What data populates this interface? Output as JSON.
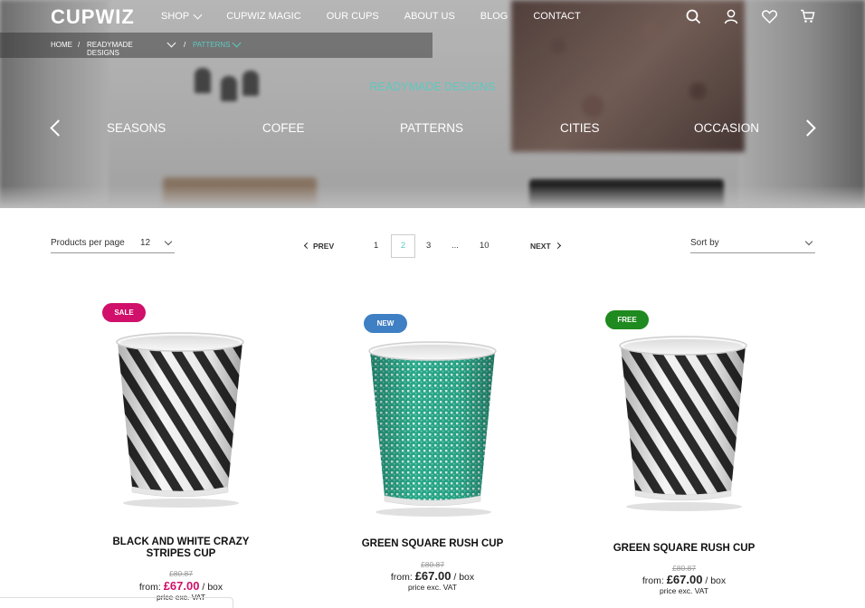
{
  "header": {
    "logo": "CUPWIZ",
    "nav": [
      {
        "label": "SHOP",
        "has_dropdown": true
      },
      {
        "label": "CUPWIZ MAGIC"
      },
      {
        "label": "OUR CUPS"
      },
      {
        "label": "ABOUT US"
      },
      {
        "label": "BLOG"
      },
      {
        "label": "CONTACT"
      }
    ],
    "icons": [
      "search-icon",
      "user-icon",
      "heart-icon",
      "cart-icon"
    ]
  },
  "breadcrumb": {
    "home": "HOME",
    "sep": "/",
    "level1": "READYMADE DESIGNS",
    "level2": "PATTERNS"
  },
  "hero": {
    "section_title": "READYMADE DESIGNS",
    "categories": [
      "SEASONS",
      "COFEE",
      "PATTERNS",
      "CITIES",
      "OCCASION"
    ]
  },
  "toolbar": {
    "per_page_label": "Products per page",
    "per_page_value": "12",
    "prev": "PREV",
    "next": "NEXT",
    "pages": [
      "1",
      "2",
      "3",
      "...",
      "10"
    ],
    "current_page": "2",
    "sort_label": "Sort by"
  },
  "products": [
    {
      "badge": "SALE",
      "badge_color": "#d0106a",
      "name_line1": "BLACK AND WHITE CRAZY",
      "name_line2": "STRIPES CUP",
      "old_price": "£80.87",
      "from": "from:",
      "price": "£67.00",
      "price_color": "#d0106a",
      "unit": "/ box",
      "vat": "price exc. VAT",
      "pattern": "stripes"
    },
    {
      "badge": "NEW",
      "badge_color": "#3f7fc4",
      "name_line1": "GREEN SQUARE RUSH CUP",
      "name_line2": "",
      "old_price": "£80.87",
      "from": "from:",
      "price": "£67.00",
      "price_color": "#222222",
      "unit": "/ box",
      "vat": "price exc. VAT",
      "pattern": "green-squares"
    },
    {
      "badge": "FREE",
      "badge_color": "#1f8a1f",
      "name_line1": "GREEN SQUARE RUSH CUP",
      "name_line2": "",
      "old_price": "£80.87",
      "from": "from:",
      "price": "£67.00",
      "price_color": "#222222",
      "unit": "/ box",
      "vat": "price exc. VAT",
      "pattern": "stripes"
    }
  ],
  "colors": {
    "accent": "#5ec8c0",
    "sale": "#d0106a",
    "new": "#3f7fc4",
    "free": "#1f8a1f"
  }
}
